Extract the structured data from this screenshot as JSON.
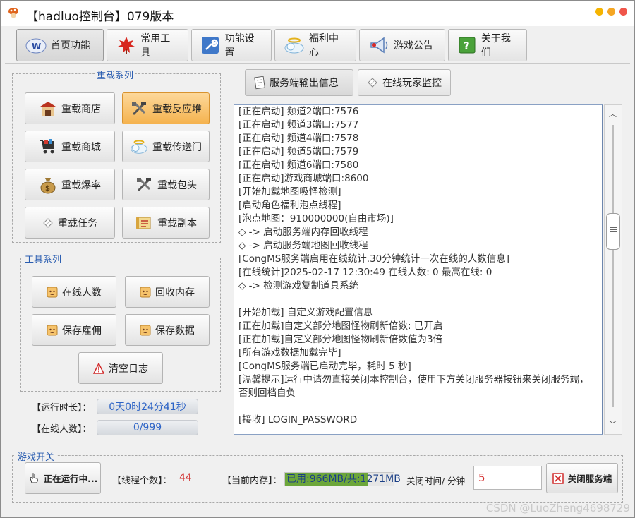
{
  "window": {
    "title": "【hadluo控制台】079版本"
  },
  "nav": [
    {
      "label": "首页功能",
      "icon": "home-w-icon"
    },
    {
      "label": "常用工具",
      "icon": "maple-leaf-icon"
    },
    {
      "label": "功能设置",
      "icon": "wrench-icon"
    },
    {
      "label": "福利中心",
      "icon": "cloud-icon"
    },
    {
      "label": "游戏公告",
      "icon": "megaphone-icon"
    },
    {
      "label": "关于我们",
      "icon": "help-icon"
    }
  ],
  "reload": {
    "title": "重载系列",
    "buttons": [
      "重载商店",
      "重载反应堆",
      "重载商城",
      "重载传送门",
      "重载爆率",
      "重载包头",
      "重载任务",
      "重载副本"
    ]
  },
  "tools": {
    "title": "工具系列",
    "buttons": [
      "在线人数",
      "回收内存",
      "保存雇佣",
      "保存数据",
      "清空日志"
    ]
  },
  "stats": {
    "runtime_label": "【运行时长】：",
    "runtime_value": "0天0时24分41秒",
    "online_label": "【在线人数】：",
    "online_value": "0/999"
  },
  "tabs": [
    "服务端输出信息",
    "在线玩家监控"
  ],
  "log": [
    "[正在启动] 频道2端口:7576",
    "[正在启动] 频道3端口:7577",
    "[正在启动] 频道4端口:7578",
    "[正在启动] 频道5端口:7579",
    "[正在启动] 频道6端口:7580",
    "[正在启动]游戏商城端口:8600",
    "[开始加载地图吸怪检测]",
    "[启动角色福利泡点线程]",
    "[泡点地图：910000000(自由市场)]",
    "◇ -> 启动服务端内存回收线程",
    "◇ -> 启动服务端地图回收线程",
    "[CongMS服务端启用在线统计.30分钟统计一次在线的人数信息]",
    "[在线统计]2025-02-17 12:30:49 在线人数: 0    最高在线: 0",
    "◇ -> 检测游戏复制道具系统",
    "",
    "[开始加载] 自定义游戏配置信息",
    "[正在加载]自定义部分地图怪物刷新倍数: 已开启",
    "[正在加载]自定义部分地图怪物刷新倍数值为3倍",
    "[所有游戏数据加载完毕]",
    "[CongMS服务端已启动完毕，耗时 5 秒]",
    "[温馨提示]运行中请勿直接关闭本控制台，使用下方关闭服务器按钮来关闭服务端，",
    "否则回档自负",
    "",
    "[接收]                LOGIN_PASSWORD"
  ],
  "game_switch": {
    "title": "游戏开关",
    "running_label": "正在运行中...",
    "threads_label": "【线程个数】：",
    "threads_value": "44",
    "memory_label": "【当前内存】：",
    "memory_text": "已用:966MB/共:1271MB",
    "memory_used_fraction": 0.76,
    "close_time_label": "关闭时间/ 分钟",
    "close_time_value": "5",
    "shutdown_label": "关闭服务端"
  },
  "watermark": "CSDN @LuoZheng4698729"
}
